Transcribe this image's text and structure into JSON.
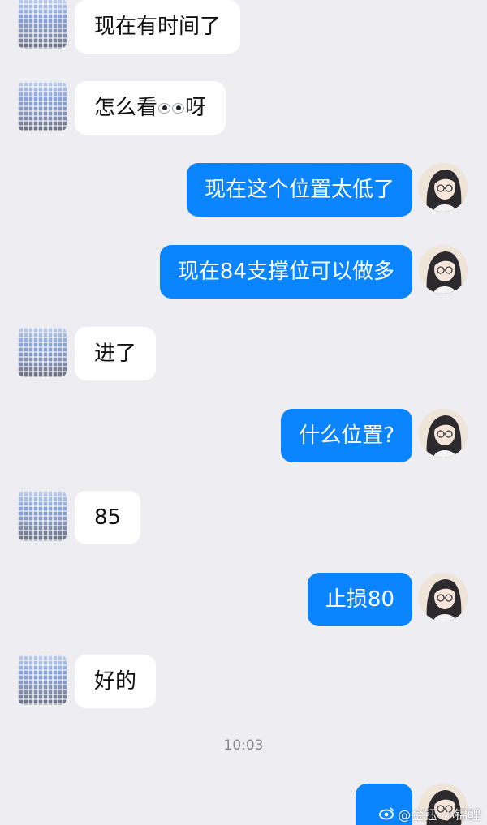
{
  "messages": [
    {
      "side": "left",
      "text": "现在有时间了"
    },
    {
      "side": "left",
      "text_before": "怎么看",
      "text_after": "呀",
      "emoji": "eyes"
    },
    {
      "side": "right",
      "text": "现在这个位置太低了"
    },
    {
      "side": "right",
      "text": "现在84支撑位可以做多"
    },
    {
      "side": "left",
      "text": "进了"
    },
    {
      "side": "right",
      "text": "什么位置?"
    },
    {
      "side": "left",
      "text": "85"
    },
    {
      "side": "right",
      "text": "止损80"
    },
    {
      "side": "left",
      "text": "好的"
    }
  ],
  "timestamp": "10:03",
  "watermark": "@金钰-小锦鲤",
  "colors": {
    "background": "#ededf2",
    "incoming_bubble": "#ffffff",
    "outgoing_bubble": "#0a85ff",
    "timestamp_text": "#8a8a8f"
  },
  "icons": {
    "incoming_avatar": "pixelated-avatar",
    "outgoing_avatar": "anime-girl-avatar",
    "watermark_icon": "weibo-eye-icon"
  }
}
